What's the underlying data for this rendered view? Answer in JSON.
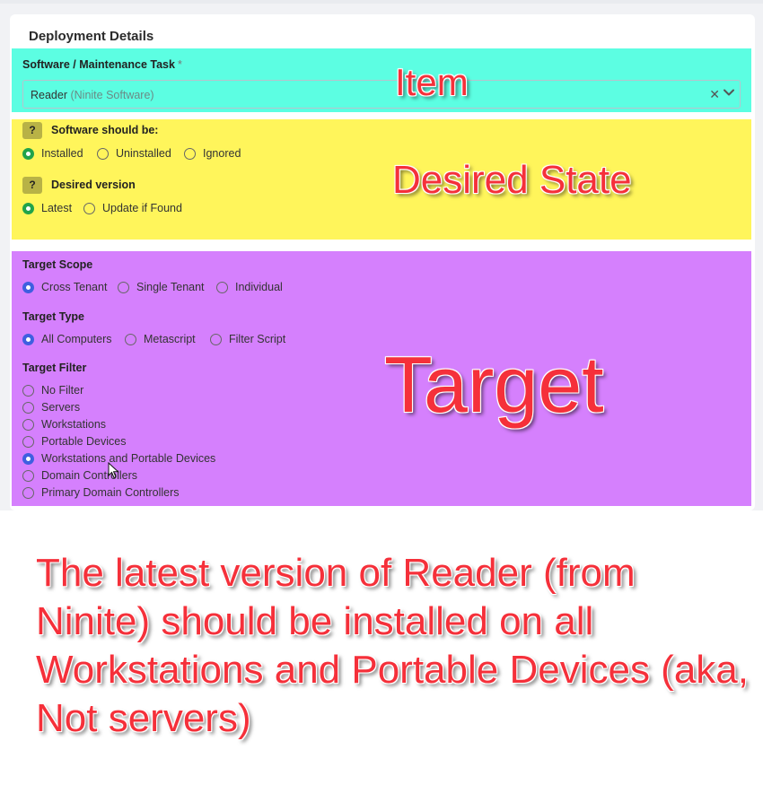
{
  "card": {
    "title": "Deployment Details"
  },
  "item": {
    "label": "Software / Maintenance Task",
    "required_mark": "*",
    "select_value": "Reader",
    "select_value_sub": "(Ninite Software)",
    "clear_icon": "close-icon",
    "dropdown_icon": "chevron-down-icon"
  },
  "desired_state": {
    "help_badge": "?",
    "software_label": "Software should be:",
    "software_options": [
      "Installed",
      "Uninstalled",
      "Ignored"
    ],
    "software_selected": "Installed",
    "version_label": "Desired version",
    "version_options": [
      "Latest",
      "Update if Found"
    ],
    "version_selected": "Latest"
  },
  "target": {
    "scope_label": "Target Scope",
    "scope_options": [
      "Cross Tenant",
      "Single Tenant",
      "Individual"
    ],
    "scope_selected": "Cross Tenant",
    "type_label": "Target Type",
    "type_options": [
      "All Computers",
      "Metascript",
      "Filter Script"
    ],
    "type_selected": "All Computers",
    "filter_label": "Target Filter",
    "filter_options": [
      "No Filter",
      "Servers",
      "Workstations",
      "Portable Devices",
      "Workstations and Portable Devices",
      "Domain Controllers",
      "Primary Domain Controllers"
    ],
    "filter_selected": "Workstations and Portable Devices"
  },
  "annotations": {
    "item": "Item",
    "desired_state": "Desired State",
    "target": "Target",
    "summary": "The latest version of Reader (from Ninite) should be installed on all Workstations and Portable Devices (aka, Not servers)"
  },
  "colors": {
    "item_section": "#5cfee2",
    "state_section": "#fff55b",
    "target_section": "#d580fd",
    "annotation_red": "#f5303a",
    "radio_green": "#21a34a",
    "radio_blue": "#3f5fe0"
  }
}
